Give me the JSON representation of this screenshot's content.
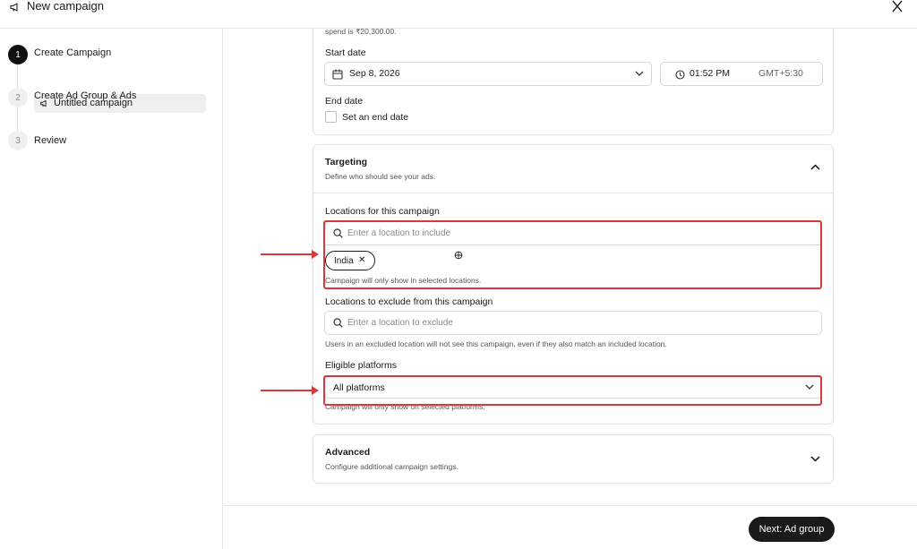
{
  "header": {
    "title": "New campaign",
    "icon": "megaphone-icon",
    "close_icon": "close-icon"
  },
  "sidebar": {
    "steps": [
      {
        "number": "1",
        "label": "Create Campaign",
        "state": "active"
      },
      {
        "number": "2",
        "label": "Create Ad Group & Ads",
        "state": "inactive"
      },
      {
        "number": "3",
        "label": "Review",
        "state": "inactive"
      }
    ],
    "sub_item": {
      "label": "Untitled campaign",
      "icon": "megaphone-icon"
    }
  },
  "schedule": {
    "spend_note": "spend is ₹20,300.00.",
    "start_date_label": "Start date",
    "start_date_value": "Sep 8, 2026",
    "start_time_value": "01:52 PM",
    "timezone": "GMT+5:30",
    "end_date_label": "End date",
    "end_date_checkbox_label": "Set an end date",
    "end_date_checked": false
  },
  "targeting": {
    "title": "Targeting",
    "subtitle": "Define who should see your ads.",
    "include_label": "Locations for this campaign",
    "include_placeholder": "Enter a location to include",
    "include_chips": [
      "India"
    ],
    "include_help": "Campaign will only show in selected locations.",
    "exclude_label": "Locations to exclude from this campaign",
    "exclude_placeholder": "Enter a location to exclude",
    "exclude_help": "Users in an excluded location will not see this campaign, even if they also match an included location.",
    "platforms_label": "Eligible platforms",
    "platforms_value": "All platforms",
    "platforms_help": "Campaign will only show on selected platforms."
  },
  "advanced": {
    "title": "Advanced",
    "subtitle": "Configure additional campaign settings."
  },
  "footer": {
    "next_label": "Next: Ad group"
  },
  "colors": {
    "highlight": "#d9393c",
    "primary_button": "#1a1a1a",
    "active_step": "#111111"
  }
}
